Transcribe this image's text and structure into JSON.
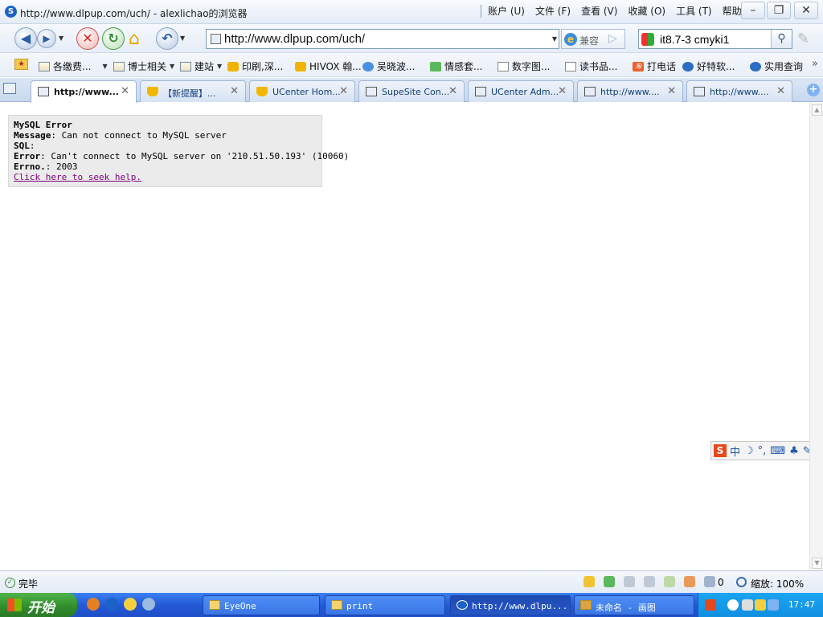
{
  "window": {
    "title": "http://www.dlpup.com/uch/ - alexlichao的浏览器",
    "menu": [
      "账户 (U)",
      "文件 (F)",
      "查看 (V)",
      "收藏 (O)",
      "工具 (T)",
      "帮助 (H)"
    ],
    "controls": {
      "minimize": "–",
      "restore": "❐",
      "close": "✕"
    }
  },
  "toolbar": {
    "url": "http://www.dlpup.com/uch/",
    "compat_label": "兼容",
    "search_value": "it8.7-3 cmyki1"
  },
  "bookmarks": [
    {
      "label": "各缴费...",
      "icon": "folder-icon",
      "has_menu": true
    },
    {
      "label": "博士相关",
      "icon": "folder-icon",
      "has_menu": true
    },
    {
      "label": "建站",
      "icon": "folder-icon",
      "has_menu": true
    },
    {
      "label": "印刷,深...",
      "icon": "hand-icon",
      "has_menu": false
    },
    {
      "label": "HIVOX 翰...",
      "icon": "hand-icon",
      "has_menu": false
    },
    {
      "label": "吴晓波...",
      "icon": "chrome-icon",
      "has_menu": false
    },
    {
      "label": "情感套...",
      "icon": "green-icon",
      "has_menu": false
    },
    {
      "label": "数字图...",
      "icon": "page-icon",
      "has_menu": false
    },
    {
      "label": "读书品...",
      "icon": "page-icon",
      "has_menu": false
    },
    {
      "label": "打电话",
      "icon": "taobao-icon",
      "has_menu": false
    },
    {
      "label": "好特软...",
      "icon": "smile-icon",
      "has_menu": false
    },
    {
      "label": "实用查询",
      "icon": "search-globe-icon",
      "has_menu": false
    }
  ],
  "tabs": [
    {
      "label": "http://www...",
      "active": true,
      "icon": "page-icon"
    },
    {
      "label": "【新提醒】...",
      "active": false,
      "icon": "trophy-icon"
    },
    {
      "label": "UCenter Hom...",
      "active": false,
      "icon": "trophy-icon"
    },
    {
      "label": "SupeSite Con...",
      "active": false,
      "icon": "page-icon"
    },
    {
      "label": "UCenter Adm...",
      "active": false,
      "icon": "page-icon"
    },
    {
      "label": "http://www....",
      "active": false,
      "icon": "page-icon"
    },
    {
      "label": "http://www....",
      "active": false,
      "icon": "page-icon"
    }
  ],
  "error": {
    "title": "MySQL Error",
    "message_label": "Message",
    "message": ": Can not connect to MySQL server",
    "sql_label": "SQL",
    "sql": ":",
    "error_label": "Error",
    "error": ": Can't connect to MySQL server on '210.51.50.193' (10060)",
    "errno_label": "Errno.",
    "errno": ": 2003",
    "help_link": "Click here to seek help."
  },
  "ime": {
    "mode": "中",
    "punct": "°,"
  },
  "status": {
    "text": "完毕",
    "count": "0",
    "zoom": "缩放: 100%"
  },
  "taskbar": {
    "start_label": "开始",
    "tasks": [
      {
        "label": "EyeOne",
        "active": false
      },
      {
        "label": "print",
        "active": false
      },
      {
        "label": "http://www.dlpu...",
        "active": true
      },
      {
        "label": "未命名 - 画图",
        "active": false
      }
    ],
    "clock": "17:47"
  },
  "colors": {
    "taskbar": "#2459d6",
    "start": "#2f8b2b",
    "error_bg": "#ebebeb",
    "link_visited": "#800080"
  }
}
